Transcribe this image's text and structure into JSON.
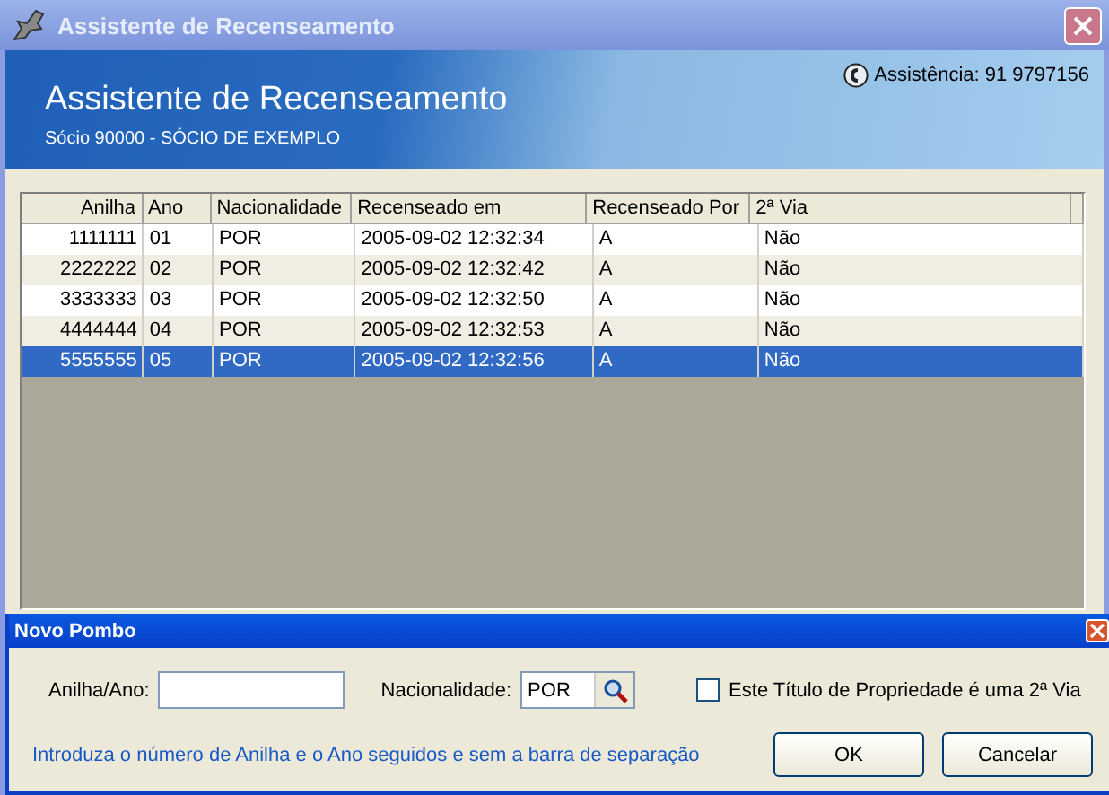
{
  "window": {
    "title": "Assistente de Recenseamento"
  },
  "header": {
    "title": "Assistente de Recenseamento",
    "subtitle": "Sócio 90000 - SÓCIO DE EXEMPLO",
    "support": "Assistência: 91 9797156"
  },
  "table": {
    "columns": [
      {
        "label": "Anilha"
      },
      {
        "label": "Ano"
      },
      {
        "label": "Nacionalidade"
      },
      {
        "label": "Recenseado em"
      },
      {
        "label": "Recenseado Por"
      },
      {
        "label": "2ª Via"
      }
    ],
    "rows": [
      {
        "cells": [
          "1111111",
          "01",
          "POR",
          "2005-09-02  12:32:34",
          "A",
          "Não"
        ],
        "selected": false
      },
      {
        "cells": [
          "2222222",
          "02",
          "POR",
          "2005-09-02  12:32:42",
          "A",
          "Não"
        ],
        "selected": false
      },
      {
        "cells": [
          "3333333",
          "03",
          "POR",
          "2005-09-02  12:32:50",
          "A",
          "Não"
        ],
        "selected": false
      },
      {
        "cells": [
          "4444444",
          "04",
          "POR",
          "2005-09-02  12:32:53",
          "A",
          "Não"
        ],
        "selected": false
      },
      {
        "cells": [
          "5555555",
          "05",
          "POR",
          "2005-09-02  12:32:56",
          "A",
          "Não"
        ],
        "selected": true
      }
    ]
  },
  "dialog": {
    "title": "Novo Pombo",
    "ring_label": "Anilha/Ano:",
    "nationality_label": "Nacionalidade:",
    "nationality_value": "POR",
    "duplicate_label": "Este Título de Propriedade é uma 2ª Via",
    "duplicate_checked": false,
    "hint": "Introduza o número de Anilha e o Ano seguidos e sem a barra de separação",
    "buttons": [
      "OK",
      "Cancelar"
    ]
  }
}
